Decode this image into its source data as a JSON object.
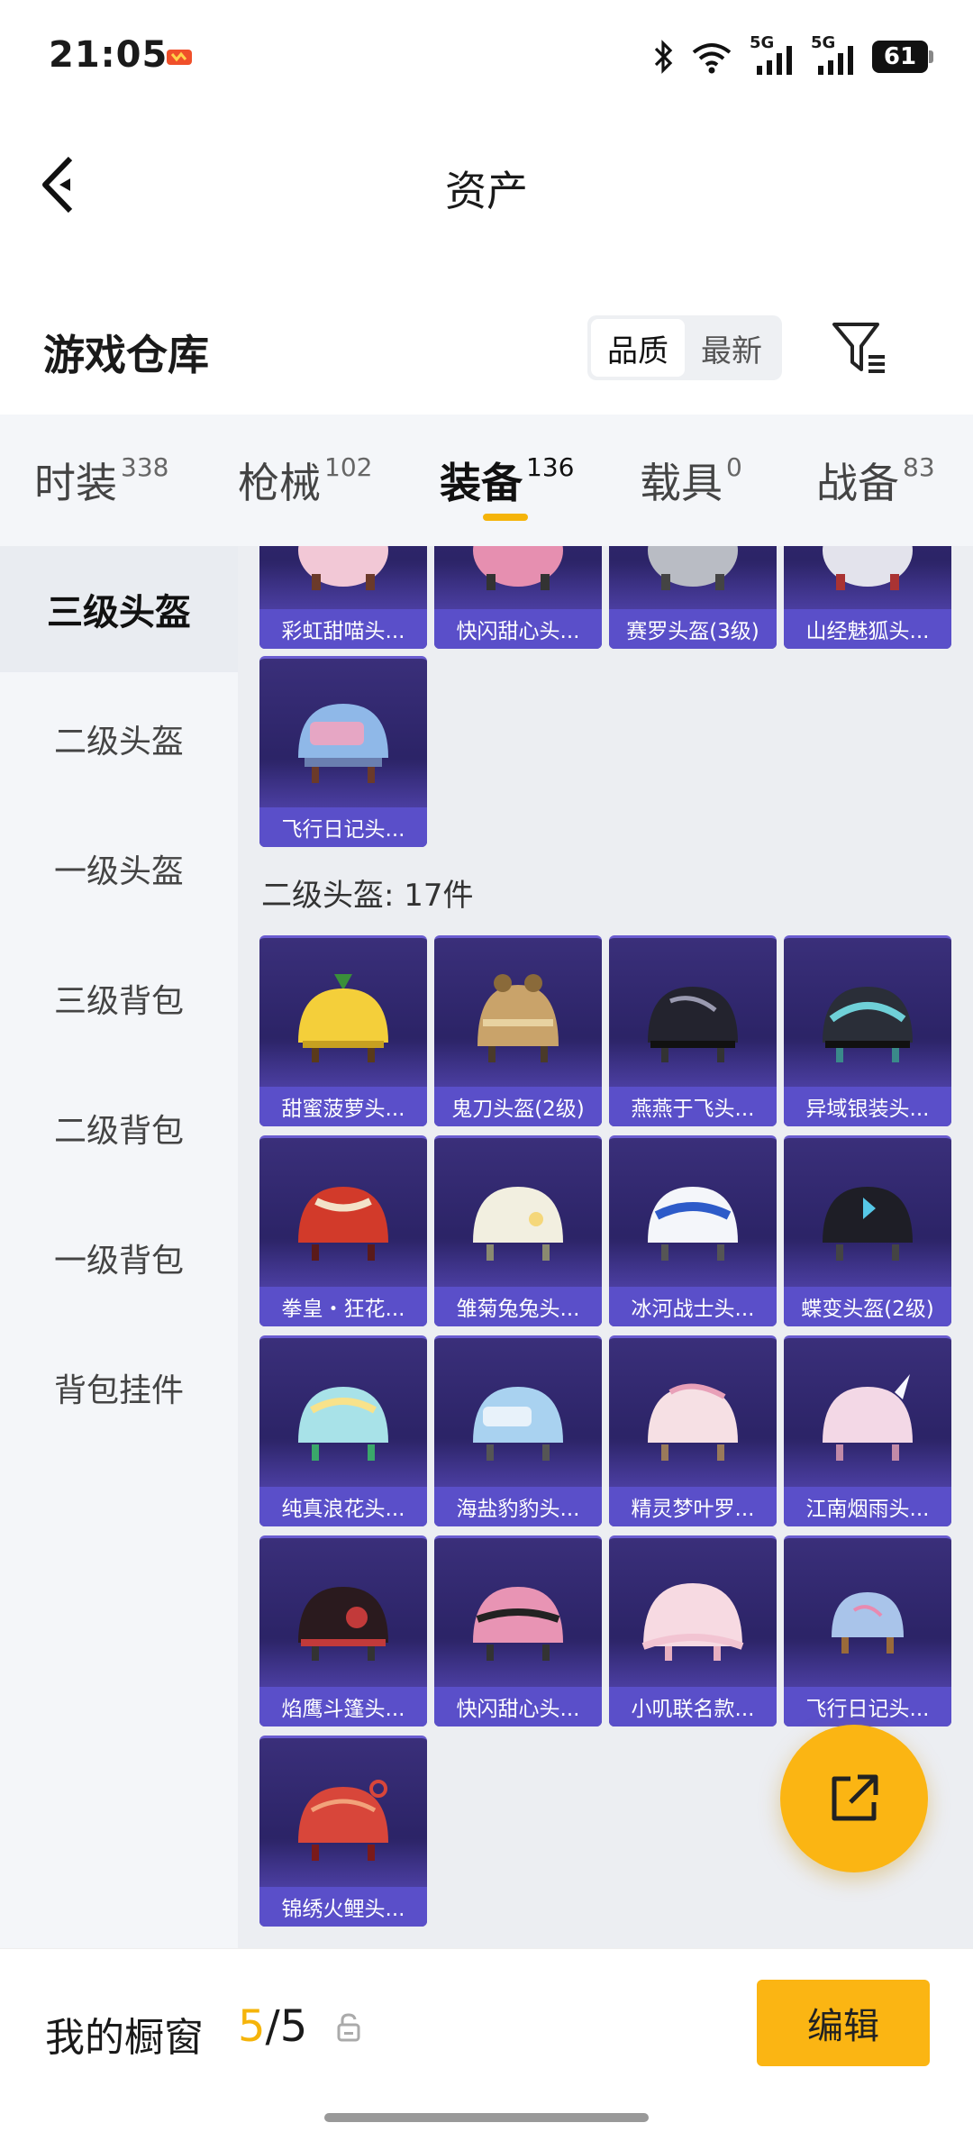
{
  "status_bar": {
    "time": "21:05",
    "network_1": "5G",
    "network_2": "5G",
    "battery": "61",
    "icons": [
      "app-notification-icon",
      "bluetooth-icon",
      "wifi-icon",
      "signal-icon",
      "signal-icon",
      "battery-icon"
    ]
  },
  "header": {
    "title": "资产"
  },
  "warehouse": {
    "title": "游戏仓库",
    "sort_options": [
      "品质",
      "最新"
    ],
    "active_sort": "品质"
  },
  "category_tabs": [
    {
      "label": "时装",
      "count": "338"
    },
    {
      "label": "枪械",
      "count": "102"
    },
    {
      "label": "装备",
      "count": "136",
      "active": true
    },
    {
      "label": "载具",
      "count": "0"
    },
    {
      "label": "战备",
      "count": "83"
    }
  ],
  "side_nav": [
    "三级头盔",
    "二级头盔",
    "一级头盔",
    "三级背包",
    "二级背包",
    "一级背包",
    "背包挂件"
  ],
  "side_nav_active": "三级头盔",
  "level3_partial_row": [
    "彩虹甜喵头...",
    "快闪甜心头...",
    "赛罗头盔(3级)",
    "山经魅狐头..."
  ],
  "level3_extra": [
    "飞行日记头..."
  ],
  "level2_heading": "二级头盔: 17件",
  "level2_items": [
    "甜蜜菠萝头...",
    "鬼刀头盔(2级)",
    "燕燕于飞头...",
    "异域银装头...",
    "拳皇・狂花...",
    "雏菊兔兔头...",
    "冰河战士头...",
    "蝶变头盔(2级)",
    "纯真浪花头...",
    "海盐豹豹头...",
    "精灵梦叶罗...",
    "江南烟雨头...",
    "焰鹰斗篷头...",
    "快闪甜心头...",
    "小叽联名款...",
    "飞行日记头...",
    "锦绣火鲤头..."
  ],
  "bottom_bar": {
    "showcase_label": "我的橱窗",
    "showcase_current": "5",
    "showcase_total": "/5",
    "edit_label": "编辑"
  },
  "colors": {
    "accent": "#fbb513",
    "card_bg": "#2b2366",
    "card_label": "#5a4fc9"
  }
}
